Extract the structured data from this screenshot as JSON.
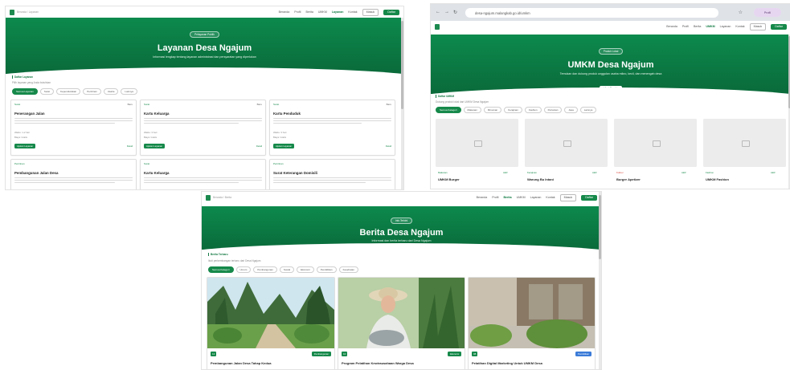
{
  "nav": {
    "links": [
      "Beranda",
      "Profil",
      "Berita",
      "UMKM",
      "Layanan",
      "Kontak"
    ],
    "login": "Masuk",
    "register": "Daftar"
  },
  "shot1": {
    "hero_pill": "Pelayanan Publik",
    "title": "Layanan Desa Ngajum",
    "subtitle": "Informasi lengkap tentang layanan administrasi dan persyaratan yang diperlukan",
    "section_label": "Daftar Layanan",
    "filters": [
      "Semua Layanan",
      "Surat",
      "Kependudukan",
      "Perizinan",
      "Usaha",
      "Lainnya"
    ],
    "cards": [
      {
        "tag": "Surat",
        "title": "Penerangan Jalan",
        "meta1": "Waktu: 1-2 hari",
        "meta2": "Biaya: Gratis",
        "btn": "Ajukan Layanan",
        "link": "Detail"
      },
      {
        "tag": "Surat",
        "title": "Kartu Keluarga",
        "meta1": "Waktu: 3 hari",
        "meta2": "Biaya: Gratis",
        "btn": "Ajukan Layanan",
        "link": "Detail"
      },
      {
        "tag": "Surat",
        "title": "Kartu Penduduk",
        "meta1": "Waktu: 3 hari",
        "meta2": "Biaya: Gratis",
        "btn": "Ajukan Layanan",
        "link": "Detail"
      },
      {
        "tag": "Perizinan",
        "title": "Pembangunan Jalan Desa"
      },
      {
        "tag": "Surat",
        "title": "Kartu Keluarga"
      },
      {
        "tag": "Perizinan",
        "title": "Surat Keterangan Domisili"
      }
    ]
  },
  "shot2": {
    "url": "desa-ngajum.malangkab.go.id/umkm",
    "profile": "Profil",
    "hero_pill": "Produk Lokal",
    "title": "UMKM Desa Ngajum",
    "subtitle": "Temukan dan dukung produk unggulan usaha mikro, kecil, dan menengah desa",
    "hero_btn": "Lihat Produk",
    "section_label": "Daftar UMKM",
    "filters": [
      "Semua Kategori",
      "Makanan",
      "Minuman",
      "Kerajinan",
      "Fashion",
      "Pertanian",
      "Jasa",
      "Lainnya"
    ],
    "cards": [
      {
        "tag": "Makanan",
        "status": "Aktif",
        "title": "UMKM Burger"
      },
      {
        "tag": "Kerajinan",
        "status": "Aktif",
        "title": "Warung Bu Intani"
      },
      {
        "tag": "Kuliner",
        "status": "Aktif",
        "title": "Burger Apetizer"
      },
      {
        "tag": "Fashion",
        "status": "Aktif",
        "title": "UMKM Fashion"
      }
    ]
  },
  "shot3": {
    "hero_pill": "Info Terkini",
    "title": "Berita Desa Ngajum",
    "subtitle": "Informasi dan berita terbaru dari Desa Ngajum",
    "section_label": "Berita Terbaru",
    "filters": [
      "Semua Kategori",
      "Umum",
      "Pembangunan",
      "Sosial",
      "Ekonomi",
      "Pendidikan",
      "Kesehatan"
    ],
    "news": [
      {
        "date": "12",
        "badge": "Pembangunan",
        "title": "Pembangunan Jalan Desa Tahap Kedua"
      },
      {
        "date": "10",
        "badge": "Ekonomi",
        "title": "Program Pelatihan Kewirausahaan Warga Desa"
      },
      {
        "date": "08",
        "badge": "Pendidikan",
        "title": "Pelatihan Digital Marketing Untuk UMKM Desa"
      }
    ]
  },
  "colors": {
    "primary": "#16894a",
    "hero": "#0c8a4d",
    "blue_badge": "#3b7bd8"
  }
}
